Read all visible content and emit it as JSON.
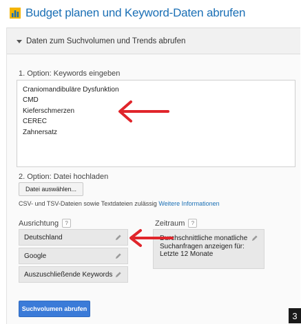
{
  "title": "Budget planen und Keyword-Daten abrufen",
  "section": {
    "header_label": "Daten zum Suchvolumen und Trends abrufen"
  },
  "option1": {
    "label": "1. Option: Keywords eingeben",
    "keywords": [
      "Craniomandibuläre Dysfunktion",
      "CMD",
      "Kieferschmerzen",
      "CEREC",
      "Zahnersatz"
    ]
  },
  "option2": {
    "label": "2. Option: Datei hochladen",
    "button_label": "Datei auswählen...",
    "hint_text": "CSV- und TSV-Dateien sowie Textdateien zulässig",
    "hint_link": "Weitere Informationen"
  },
  "ausrichtung": {
    "label": "Ausrichtung",
    "help": "?",
    "items": [
      "Deutschland",
      "Google",
      "Auszuschließende Keywords"
    ]
  },
  "zeitraum": {
    "label": "Zeitraum",
    "help": "?",
    "text": "Durchschnittliche monatliche Suchanfragen anzeigen für: Letzte 12 Monate"
  },
  "submit_button": "Suchvolumen abrufen",
  "page_number": "3",
  "colors": {
    "accent": "#1a6fb5",
    "primary_button": "#3b7bd8",
    "annotation_arrow": "#e0252b"
  },
  "icons": {
    "logo": "keyword-planner-logo-icon",
    "caret": "caret-down-icon",
    "edit": "pencil-icon",
    "annotation": "red-arrow-icon"
  }
}
